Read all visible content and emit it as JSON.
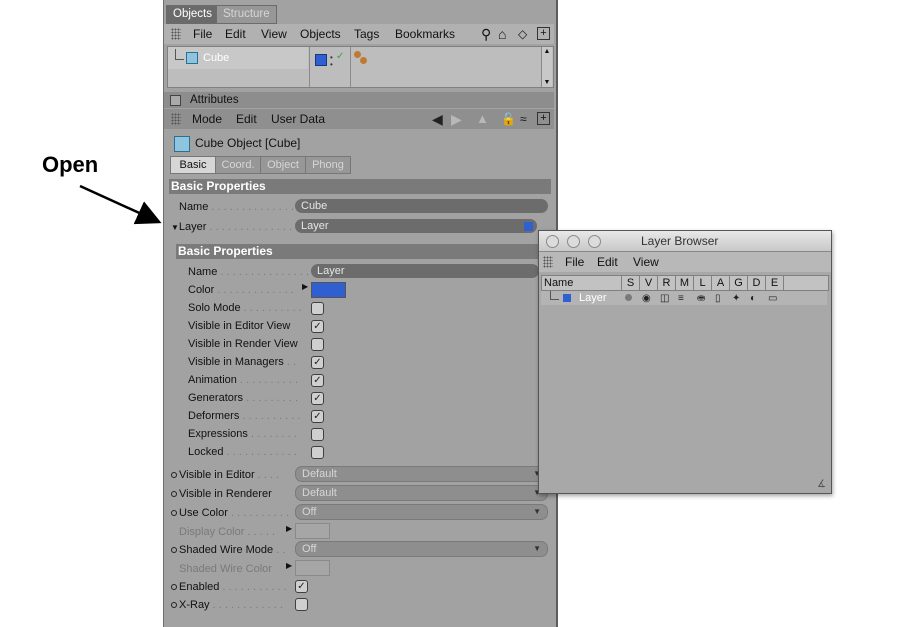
{
  "annotation": {
    "label": "Open"
  },
  "objects_panel": {
    "tabs": [
      "Objects",
      "Structure"
    ],
    "menu": [
      "File",
      "Edit",
      "View",
      "Objects",
      "Tags",
      "Bookmarks"
    ],
    "object_row": {
      "name": "Cube"
    }
  },
  "attributes": {
    "header": "Attributes",
    "menu": [
      "Mode",
      "Edit",
      "User Data"
    ],
    "object_title": "Cube Object [Cube]",
    "tabs": [
      "Basic",
      "Coord.",
      "Object",
      "Phong"
    ],
    "section": "Basic Properties",
    "name_label": "Name",
    "name_value": "Cube",
    "layer_label": "Layer",
    "layer_value": "Layer",
    "layer_sub": {
      "section": "Basic Properties",
      "name_label": "Name",
      "name_value": "Layer",
      "color_label": "Color",
      "color_value": "#2f5fd0",
      "rows": [
        {
          "label": "Solo Mode",
          "checked": false
        },
        {
          "label": "Visible in Editor View",
          "checked": true
        },
        {
          "label": "Visible in Render View",
          "checked": false
        },
        {
          "label": "Visible in Managers",
          "checked": true
        },
        {
          "label": "Animation",
          "checked": true
        },
        {
          "label": "Generators",
          "checked": true
        },
        {
          "label": "Deformers",
          "checked": true
        },
        {
          "label": "Expressions",
          "checked": false
        },
        {
          "label": "Locked",
          "checked": false
        }
      ]
    },
    "props": {
      "visible_editor": {
        "label": "Visible in Editor",
        "value": "Default"
      },
      "visible_renderer": {
        "label": "Visible in Renderer",
        "value": "Default"
      },
      "use_color": {
        "label": "Use Color",
        "value": "Off"
      },
      "display_color": {
        "label": "Display Color"
      },
      "shaded_wire_mode": {
        "label": "Shaded Wire Mode",
        "value": "Off"
      },
      "shaded_wire_color": {
        "label": "Shaded Wire Color"
      },
      "enabled": {
        "label": "Enabled",
        "checked": true
      },
      "xray": {
        "label": "X-Ray",
        "checked": false
      }
    }
  },
  "layer_browser": {
    "title": "Layer Browser",
    "menu": [
      "File",
      "Edit",
      "View"
    ],
    "columns": [
      "Name",
      "S",
      "V",
      "R",
      "M",
      "L",
      "A",
      "G",
      "D",
      "E"
    ],
    "row": {
      "name": "Layer",
      "color": "#2f5fd0"
    }
  }
}
